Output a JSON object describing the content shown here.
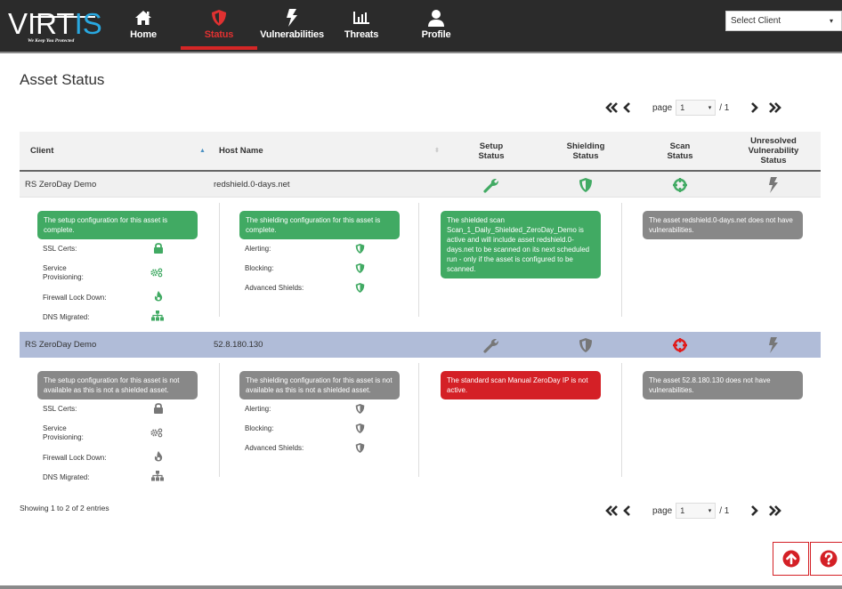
{
  "app": {
    "logo_text_a": "VIRT",
    "logo_text_b": "IS",
    "tagline": "We Keep You Protected"
  },
  "nav": {
    "items": [
      {
        "label": "Home",
        "icon": "home-icon",
        "active": false
      },
      {
        "label": "Status",
        "icon": "shield-icon",
        "active": true
      },
      {
        "label": "Vulnerabilities",
        "icon": "bolt-icon",
        "active": false
      },
      {
        "label": "Threats",
        "icon": "bar-chart-icon",
        "active": false
      },
      {
        "label": "Profile",
        "icon": "user-icon",
        "active": false
      }
    ],
    "client_select": {
      "value": "Select Client",
      "caret": "▾"
    }
  },
  "page": {
    "title": "Asset Status"
  },
  "pager": {
    "first": "«",
    "prev": "‹",
    "page_label": "page",
    "page_value": "1",
    "page_caret": "▾",
    "of_label": "/ 1",
    "next": "›",
    "last": "»"
  },
  "table": {
    "headers": {
      "client": "Client",
      "host": "Host Name",
      "setup_1": "Setup",
      "setup_2": "Status",
      "shield_1": "Shielding",
      "shield_2": "Status",
      "scan_1": "Scan",
      "scan_2": "Status",
      "vuln_1": "Unresolved",
      "vuln_2": "Vulnerability",
      "vuln_3": "Status"
    },
    "sort": {
      "client": "▲",
      "host": "⬍"
    },
    "labels": {
      "ssl": "SSL Certs:",
      "svc_1": "Service",
      "svc_2": "Provisioning:",
      "fw": "Firewall Lock Down:",
      "dns": "DNS Migrated:",
      "alerting": "Alerting:",
      "blocking": "Blocking:",
      "adv": "Advanced Shields:"
    },
    "rows": [
      {
        "client": "RS ZeroDay Demo",
        "host": "redshield.0-days.net",
        "setup_status": "complete",
        "shield_status": "complete",
        "scan_status": "active",
        "vuln_status": "none",
        "setup_msg": "The setup configuration for this asset is complete.",
        "shield_msg": "The shielding configuration for this asset is complete.",
        "scan_msg": "The shielded scan Scan_1_Daily_Shielded_ZeroDay_Demo is active and will include asset redshield.0-days.net to be scanned on its next scheduled run - only if the asset is configured to be scanned.",
        "vuln_msg": "The asset redshield.0-days.net does not have vulnerabilities."
      },
      {
        "client": "RS ZeroDay Demo",
        "host": "52.8.180.130",
        "setup_status": "not available",
        "shield_status": "not available",
        "scan_status": "not active",
        "vuln_status": "none",
        "setup_msg": "The setup configuration for this asset is not available as this is not a shielded asset.",
        "shield_msg": "The shielding configuration for this asset is not available as this is not a shielded asset.",
        "scan_msg": "The standard scan Manual ZeroDay IP is not active.",
        "vuln_msg": "The asset 52.8.180.130 does not have vulnerabilities."
      }
    ]
  },
  "footer": {
    "showing": "Showing 1 to 2 of 2 entries"
  },
  "colors": {
    "ok": "#41aa63",
    "neutral": "#888888",
    "alert": "#d42026",
    "nav_bg": "#2b2b2b",
    "selected_row": "#b0bcd8"
  }
}
